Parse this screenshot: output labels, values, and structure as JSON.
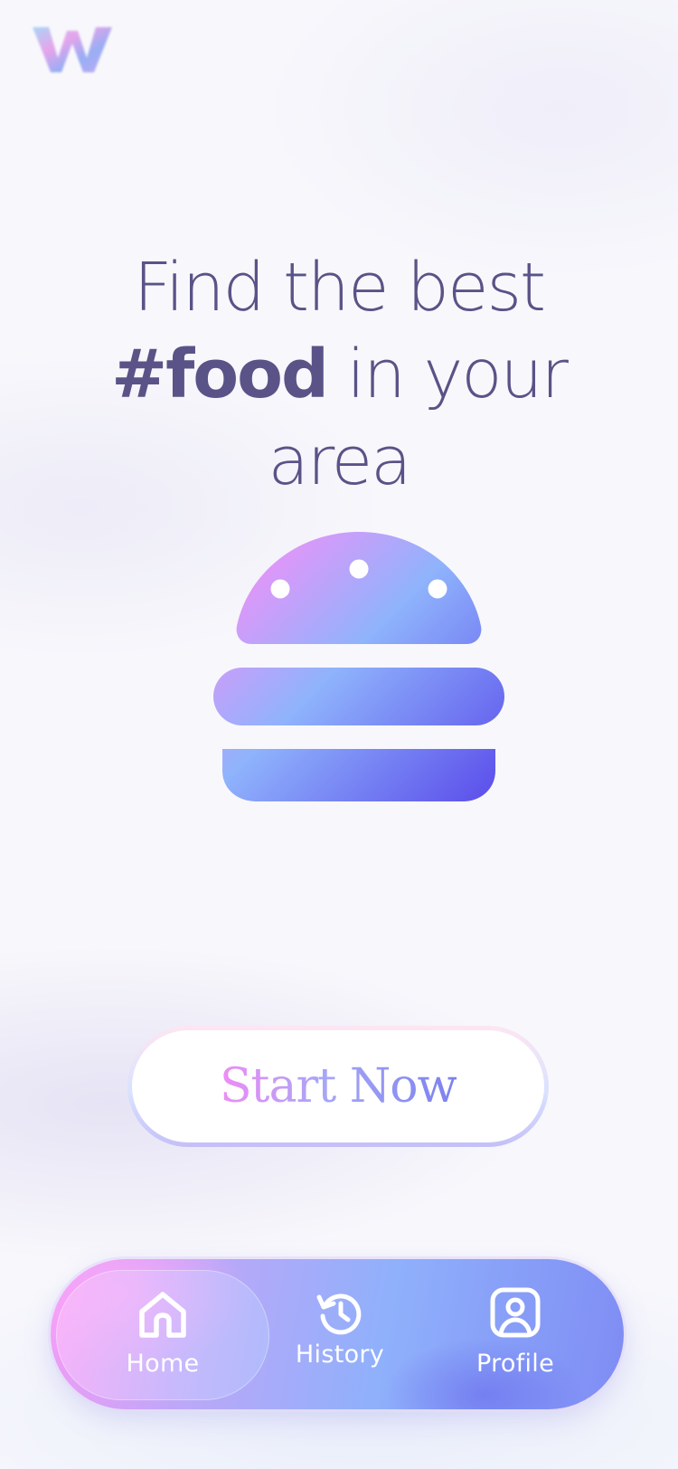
{
  "app": {
    "logo_icon": "w-logo-icon"
  },
  "hero": {
    "line1": "Find the best",
    "hashtag": "#food",
    "line2_rest": " in your",
    "line3": "area",
    "illustration_icon": "burger-icon"
  },
  "cta": {
    "label": "Start Now"
  },
  "tabbar": {
    "active": "home",
    "tabs": [
      {
        "id": "home",
        "label": "Home",
        "icon": "home-icon"
      },
      {
        "id": "history",
        "label": "History",
        "icon": "history-icon"
      },
      {
        "id": "profile",
        "label": "Profile",
        "icon": "profile-icon"
      }
    ]
  },
  "colors": {
    "headline": "#5a5387",
    "gradient_pink": "#f29cf6",
    "gradient_blue": "#8fb0fb",
    "gradient_indigo": "#6b63ee"
  }
}
